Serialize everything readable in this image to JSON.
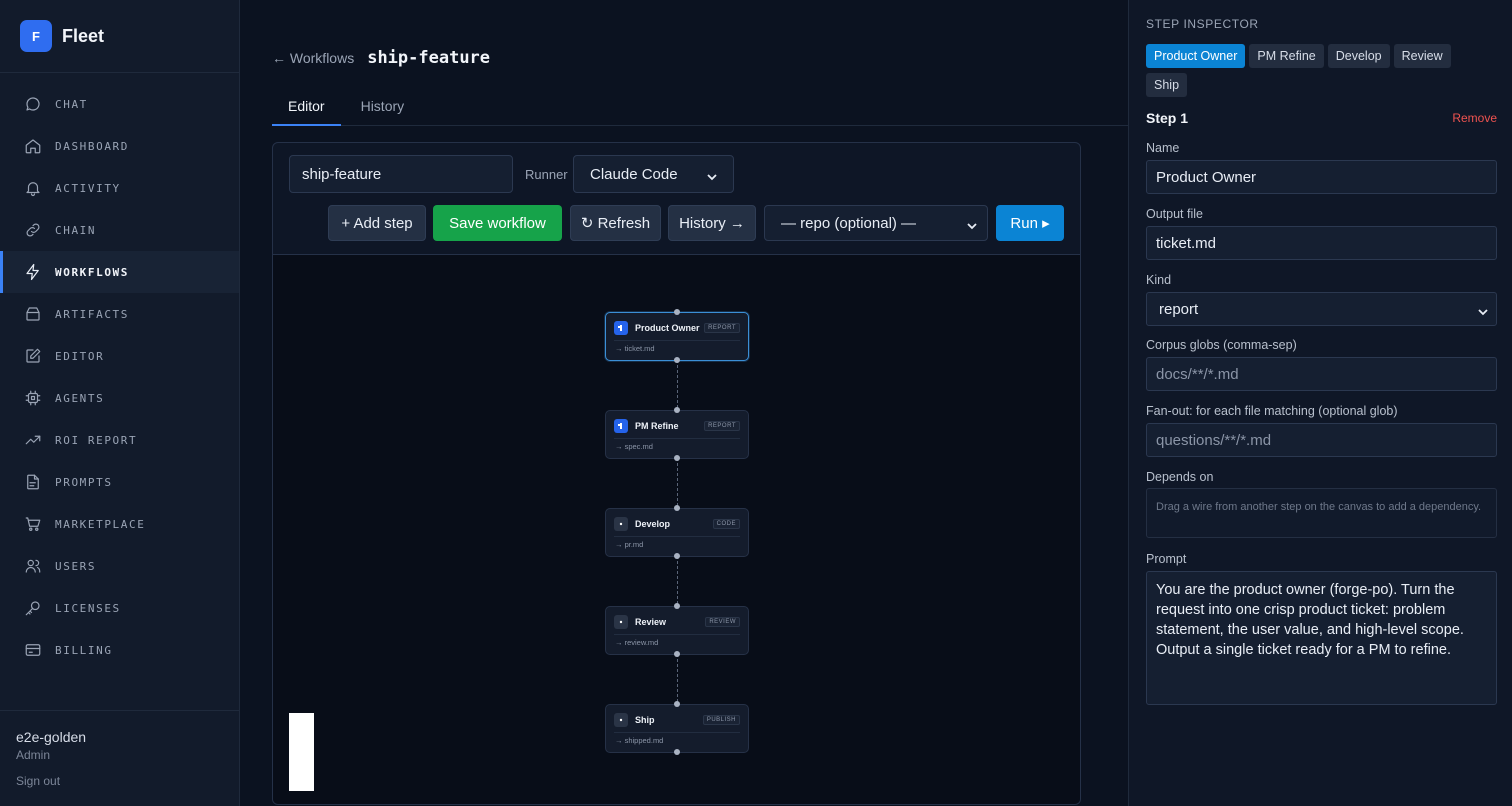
{
  "app": {
    "name": "Fleet",
    "logo_letter": "F"
  },
  "sidebar": {
    "items": [
      {
        "label": "CHAT",
        "icon": "chat-bubble-icon"
      },
      {
        "label": "DASHBOARD",
        "icon": "home-icon"
      },
      {
        "label": "ACTIVITY",
        "icon": "bell-icon"
      },
      {
        "label": "CHAIN",
        "icon": "link-icon"
      },
      {
        "label": "WORKFLOWS",
        "icon": "lightning-icon",
        "active": true
      },
      {
        "label": "ARTIFACTS",
        "icon": "archive-icon"
      },
      {
        "label": "EDITOR",
        "icon": "edit-icon"
      },
      {
        "label": "AGENTS",
        "icon": "chip-icon"
      },
      {
        "label": "ROI REPORT",
        "icon": "trending-up-icon"
      },
      {
        "label": "PROMPTS",
        "icon": "note-icon"
      },
      {
        "label": "MARKETPLACE",
        "icon": "cart-icon"
      },
      {
        "label": "USERS",
        "icon": "users-icon"
      },
      {
        "label": "LICENSES",
        "icon": "key-icon"
      },
      {
        "label": "BILLING",
        "icon": "credit-card-icon"
      }
    ],
    "user": {
      "name": "e2e-golden",
      "role": "Admin",
      "sign_out": "Sign out"
    }
  },
  "header": {
    "back_label": "← Workflows",
    "title": "ship-feature",
    "tabs": [
      {
        "label": "Editor",
        "active": true
      },
      {
        "label": "History"
      }
    ]
  },
  "toolbar": {
    "workflow_name": "ship-feature",
    "runner_label": "Runner",
    "runner_value": "Claude Code",
    "add_step": "+ Add step",
    "save": "Save workflow",
    "refresh": "↻ Refresh",
    "history": "History →",
    "repo_placeholder": "— repo (optional) —",
    "run": "Run ▸"
  },
  "canvas": {
    "nodes": [
      {
        "title": "Product Owner",
        "kind": "REPORT",
        "output": "→ ticket.md",
        "icon": "pm-icon",
        "selected": true
      },
      {
        "title": "PM Refine",
        "kind": "REPORT",
        "output": "→ spec.md",
        "icon": "pm-icon"
      },
      {
        "title": "Develop",
        "kind": "CODE",
        "output": "→ pr.md",
        "icon": "dot-icon"
      },
      {
        "title": "Review",
        "kind": "REVIEW",
        "output": "→ review.md",
        "icon": "dot-icon"
      },
      {
        "title": "Ship",
        "kind": "PUBLISH",
        "output": "→ shipped.md",
        "icon": "dot-icon"
      }
    ]
  },
  "inspector": {
    "title": "STEP INSPECTOR",
    "chips": [
      {
        "label": "Product Owner",
        "active": true
      },
      {
        "label": "PM Refine"
      },
      {
        "label": "Develop"
      },
      {
        "label": "Review"
      },
      {
        "label": "Ship"
      }
    ],
    "step_label": "Step 1",
    "remove": "Remove",
    "name_label": "Name",
    "name_value": "Product Owner",
    "output_label": "Output file",
    "output_value": "ticket.md",
    "kind_label": "Kind",
    "kind_value": "report",
    "corpus_label": "Corpus globs (comma-sep)",
    "corpus_placeholder": "docs/**/*.md",
    "fanout_label": "Fan-out: for each file matching (optional glob)",
    "fanout_placeholder": "questions/**/*.md",
    "depends_label": "Depends on",
    "depends_hint": "Drag a wire from another step on the canvas to add a dependency.",
    "prompt_label": "Prompt",
    "prompt_value": "You are the product owner (forge-po). Turn the request into one crisp product ticket: problem statement, the user value, and high-level scope. Output a single ticket ready for a PM to refine."
  },
  "colors": {
    "accent": "#3b82f6",
    "primary_button": "#0b84d4",
    "save_button": "#16a34a",
    "danger": "#ef5350"
  }
}
